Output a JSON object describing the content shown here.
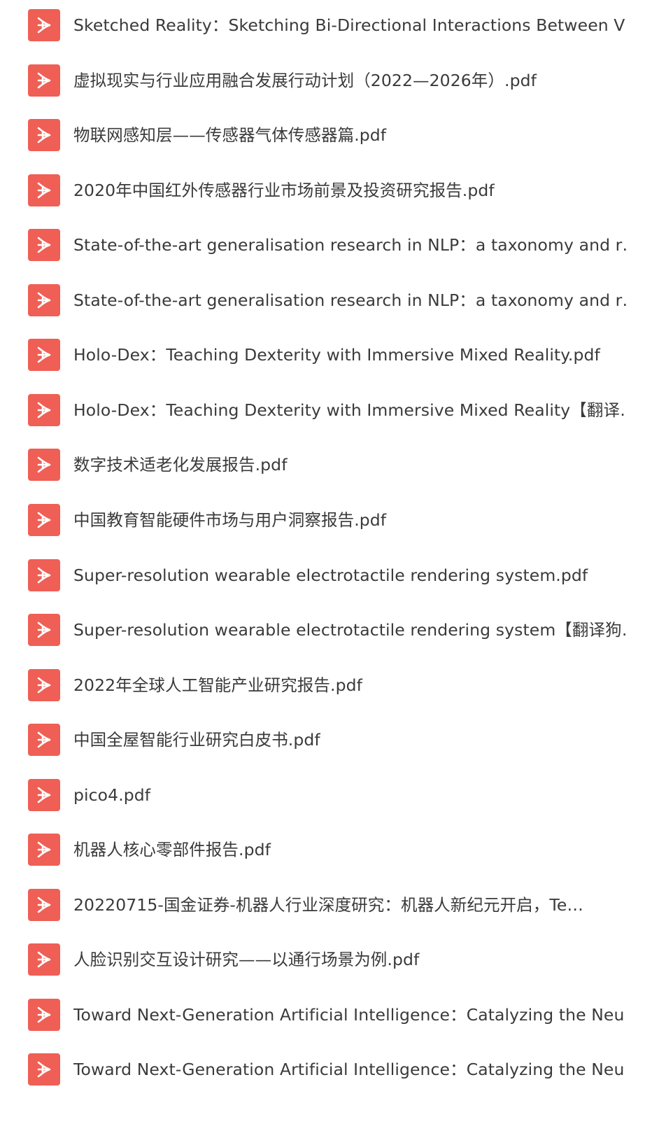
{
  "theme": {
    "icon_color": "#ef5f55",
    "text_color": "#3a3a3a",
    "background": "#ffffff"
  },
  "file_icon": "pdf-icon",
  "files": [
    {
      "name": "Sketched Reality：Sketching Bi-Directional Interactions Between Vi…"
    },
    {
      "name": "虚拟现实与行业应用融合发展行动计划（2022—2026年）.pdf"
    },
    {
      "name": "物联网感知层——传感器气体传感器篇.pdf"
    },
    {
      "name": "2020年中国红外传感器行业市场前景及投资研究报告.pdf"
    },
    {
      "name": "State-of-the-art generalisation research in NLP：a taxonomy and r…"
    },
    {
      "name": "State-of-the-art generalisation research in NLP：a taxonomy and r…"
    },
    {
      "name": "Holo-Dex：Teaching Dexterity with Immersive Mixed Reality.pdf"
    },
    {
      "name": "Holo-Dex：Teaching Dexterity with Immersive Mixed Reality【翻译…"
    },
    {
      "name": "数字技术适老化发展报告.pdf"
    },
    {
      "name": "中国教育智能硬件市场与用户洞察报告.pdf"
    },
    {
      "name": "Super-resolution wearable electrotactile rendering system.pdf"
    },
    {
      "name": "Super-resolution wearable electrotactile rendering system【翻译狗…"
    },
    {
      "name": "2022年全球人工智能产业研究报告.pdf"
    },
    {
      "name": "中国全屋智能行业研究白皮书.pdf"
    },
    {
      "name": "pico4.pdf"
    },
    {
      "name": "机器人核心零部件报告.pdf"
    },
    {
      "name": "20220715-国金证券-机器人行业深度研究：机器人新纪元开启，Te…"
    },
    {
      "name": "人脸识别交互设计研究——以通行场景为例.pdf"
    },
    {
      "name": "Toward Next-Generation Artificial Intelligence：Catalyzing the Neu…"
    },
    {
      "name": "Toward Next-Generation Artificial Intelligence：Catalyzing the Neu…"
    }
  ]
}
